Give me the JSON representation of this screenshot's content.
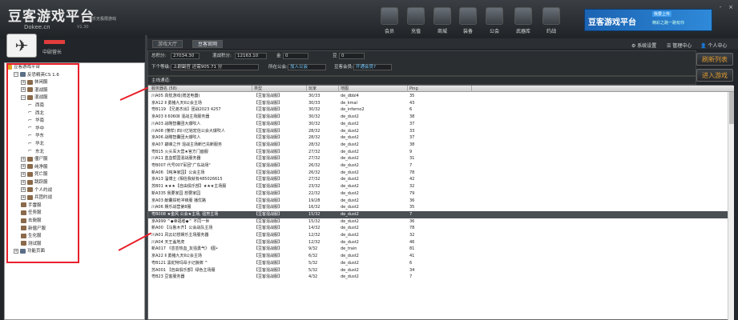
{
  "app": {
    "logo_text": "豆客游戏平台",
    "logo_tagline": "快乐无极限游戏",
    "logo_url": "Dokee.cn",
    "logo_version": "V1.30"
  },
  "topnav": [
    {
      "label": "会员",
      "icon": "vip-icon"
    },
    {
      "label": "充值",
      "icon": "recharge-icon"
    },
    {
      "label": "商城",
      "icon": "mall-icon"
    },
    {
      "label": "装备",
      "icon": "equipment-icon"
    },
    {
      "label": "公会",
      "icon": "guild-icon"
    },
    {
      "label": "武器库",
      "icon": "armory-icon"
    },
    {
      "label": "约战",
      "icon": "challenge-icon"
    }
  ],
  "banner": {
    "title": "豆客游戏平台",
    "upload": "我要上传",
    "slogan": "精彩之路一路有你"
  },
  "window_controls": [
    "-",
    "×"
  ],
  "user": {
    "level": "中尉营长"
  },
  "tabs": [
    "游戏大厅",
    "豆客官网"
  ],
  "toolbar_right": {
    "settings": "系统设置",
    "manager": "管理中心",
    "personal": "个人中心"
  },
  "info": {
    "total_points_label": "总积分:",
    "total_points": "27034.30",
    "mix_points_label": "混战积分:",
    "mix_points": "12163.10",
    "gold_label": "金",
    "gold": "0",
    "bean_label": "豆",
    "bean": "0",
    "next_level_label": "下个等级:",
    "next_level": "上尉副官 还需905.71 分",
    "guild_label": "所在公会:",
    "guild": "加入公会",
    "vip_label": "豆客会员:",
    "vip": "开通会员?",
    "main_server_label": "主线通道:"
  },
  "buttons": {
    "refresh": "刷新列表",
    "join": "进入游戏"
  },
  "tree": [
    {
      "label": "豆客游戏平台",
      "level": 0,
      "kind": "root"
    },
    {
      "label": "反恐精英CS 1.6",
      "level": 1,
      "kind": "minus"
    },
    {
      "label": "休闲服",
      "level": 2,
      "kind": "plus"
    },
    {
      "label": "混战服",
      "level": 2,
      "kind": "plus"
    },
    {
      "label": "混战服",
      "level": 2,
      "kind": "minus"
    },
    {
      "label": "西南",
      "level": 3,
      "kind": "gun"
    },
    {
      "label": "西北",
      "level": 3,
      "kind": "gun"
    },
    {
      "label": "华南",
      "level": 3,
      "kind": "gun"
    },
    {
      "label": "华中",
      "level": 3,
      "kind": "gun"
    },
    {
      "label": "华东",
      "level": 3,
      "kind": "gun"
    },
    {
      "label": "华北",
      "level": 3,
      "kind": "gun"
    },
    {
      "label": "东北",
      "level": 3,
      "kind": "gun"
    },
    {
      "label": "僵尸服",
      "level": 2,
      "kind": "plus"
    },
    {
      "label": "纯净服",
      "level": 2,
      "kind": "plus"
    },
    {
      "label": "死亡服",
      "level": 2,
      "kind": "plus"
    },
    {
      "label": "跳跃服",
      "level": 2,
      "kind": "plus"
    },
    {
      "label": "个人约战",
      "level": 2,
      "kind": "plus"
    },
    {
      "label": "兵团约战",
      "level": 2,
      "kind": "plus"
    },
    {
      "label": "手雷服",
      "level": 2,
      "kind": "leaf"
    },
    {
      "label": "任务服",
      "level": 2,
      "kind": "leaf"
    },
    {
      "label": "击毙服",
      "level": 2,
      "kind": "leaf"
    },
    {
      "label": "新僵尸服",
      "level": 2,
      "kind": "leaf"
    },
    {
      "label": "生化服",
      "level": 2,
      "kind": "leaf"
    },
    {
      "label": "测试服",
      "level": 2,
      "kind": "leaf"
    },
    {
      "label": "功能页面",
      "level": 1,
      "kind": "plus"
    }
  ],
  "grid": {
    "columns": [
      "服务器名 (58)",
      "类型",
      "玩家",
      "地图",
      "Ping"
    ],
    "rows": [
      [
        "川A05 高枕游戏(赠送电器)",
        "【豆客混战服】",
        "30/33",
        "de_dbbl4",
        "35"
      ],
      [
        "京A12 Ⅱ 勇猪九天Ⅱ公会主场",
        "【豆客混战服】",
        "30/33",
        "de_kmal",
        "43"
      ],
      [
        "粤B119 【兄弟杰出】团战2023 4257",
        "【豆客混战服】",
        "30/32",
        "de_inferno2",
        "6"
      ],
      [
        "京A03 Ⅱ 6060Ⅱ 混战主场服务器",
        "【豆客混战服】",
        "30/32",
        "de_dust2",
        "38"
      ],
      [
        "川A03 战略智囊团大爆吹人",
        "【豆客混战服】",
        "30/32",
        "de_dust2",
        "37"
      ],
      [
        "川A08 (懂样) 四川亿铭宏信公会大爆吹人",
        "【豆客混战服】",
        "28/32",
        "de_dust2",
        "33"
      ],
      [
        "京A06 战略智囊团大爆吹人",
        "【豆客混战服】",
        "28/32",
        "de_dust2",
        "37"
      ],
      [
        "京A07 巅峰之作 混战主场断已充断服务",
        "【豆客混战服】",
        "28/32",
        "de_dust2",
        "38"
      ],
      [
        "粤B15 火头军大营★官方门面服",
        "【豆客混战服】",
        "27/32",
        "de_dust2",
        "9"
      ],
      [
        "川A11 蓝血帮国混战服务器",
        "【豆客混战服】",
        "27/32",
        "de_dust2",
        "31"
      ],
      [
        "粤B007 代号007军团\"广东战场\"",
        "【豆客混战服】",
        "26/32",
        "de_dust2",
        "7"
      ],
      [
        "新A06 【纯净家园】公会主场",
        "【豆客混战服】",
        "26/32",
        "de_dust2",
        "78"
      ],
      [
        "京A13 淄博士 (相信我就有485026615",
        "【豆客混战服】",
        "27/32",
        "de_dust2",
        "42"
      ],
      [
        "苏B01 ★★★【自由俱乐部】★★★主场服",
        "【豆客混战服】",
        "23/32",
        "de_dust2",
        "32"
      ],
      [
        "新A335 我要家园 想要家园",
        "【豆客混战服】",
        "22/32",
        "de_dust2",
        "79"
      ],
      [
        "京A03 献囊捍枪冲锋服 播优路",
        "【豆客混战服】",
        "19/28",
        "de_dust2",
        "36"
      ],
      [
        "川A06 娱乐战营第8服",
        "【豆客混战服】",
        "16/32",
        "de_dust2",
        "35"
      ],
      [
        "粤B008 ★金风 公会★主场, 强势主场",
        "【豆客混战服】",
        "15/32",
        "de_dust2",
        "7"
      ],
      [
        "京A999 ^◆幸福者◆^ 不同一世",
        "【豆客混战服】",
        "15/32",
        "de_dust2",
        "36"
      ],
      [
        "新A00 【马鲁木齐】公会战队主场",
        "【豆客混战服】",
        "14/32",
        "de_dust2",
        "78"
      ],
      [
        "川A01 风云幻想娱乐主场服务器",
        "【豆客混战服】",
        "12/32",
        "de_dust2",
        "32"
      ],
      [
        "川A04 天王盖地虎",
        "【豆客混战服】",
        "12/32",
        "de_dust2",
        "46"
      ],
      [
        "新A017 《芸芸热血_友强勇气》 I图•",
        "【豆客混战服】",
        "9/32",
        "de_train",
        "81"
      ],
      [
        "京A22 Ⅱ 勇猪九天Ⅱ公会主场",
        "【豆客混战服】",
        "6/32",
        "de_dust2",
        "41"
      ],
      [
        "粤B121 黑蛇特玛昂子记狼牌 ^",
        "【豆客混战服】",
        "5/32",
        "de_dust2",
        "6"
      ],
      [
        "苏A001 【自由俱乐部】绿色主场服",
        "【豆客混战服】",
        "5/32",
        "de_dust2",
        "34"
      ],
      [
        "粤B23 豆客服务器",
        "【豆客混战服】",
        "4/32",
        "de_dust2",
        "7"
      ]
    ]
  },
  "colors": {
    "accent_red": "#e8202a",
    "button_text": "#e09a30",
    "selected_row": "#4a4f54"
  }
}
